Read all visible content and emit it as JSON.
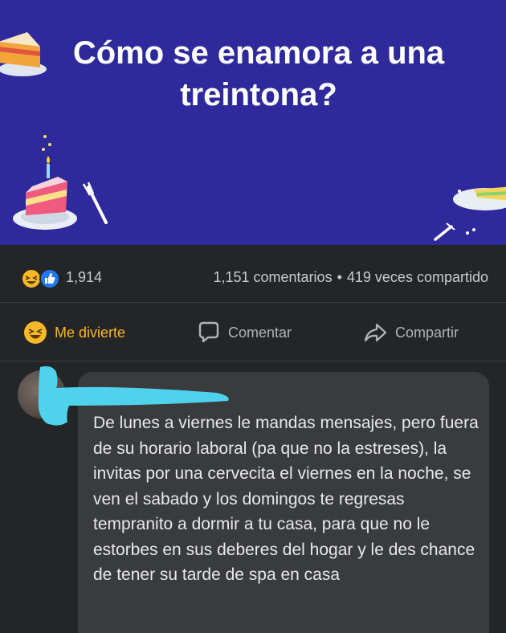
{
  "post": {
    "title": "Cómo se enamora a una\ntreintona?",
    "background_color": "#2e2a9c"
  },
  "stats": {
    "reaction_icons": [
      "haha-icon",
      "like-icon"
    ],
    "reaction_count": "1,914",
    "comments": "1,151 comentarios",
    "separator": "•",
    "shares": "419 veces compartido"
  },
  "actions": {
    "react_label": "Me divierte",
    "comment_label": "Comentar",
    "share_label": "Compartir",
    "react_color": "#f7b928"
  },
  "comment": {
    "text": "De lunes a viernes le mandas mensajes, pero fuera de su horario laboral (pa que no la estreses), la invitas por una cervecita el viernes en la noche, se ven el sabado y los domingos te regresas tempranito a dormir a tu casa, para que no le estorbes en sus deberes del hogar y le des chance de tener su tarde de spa en casa",
    "redaction_color": "#4fd3ec"
  }
}
